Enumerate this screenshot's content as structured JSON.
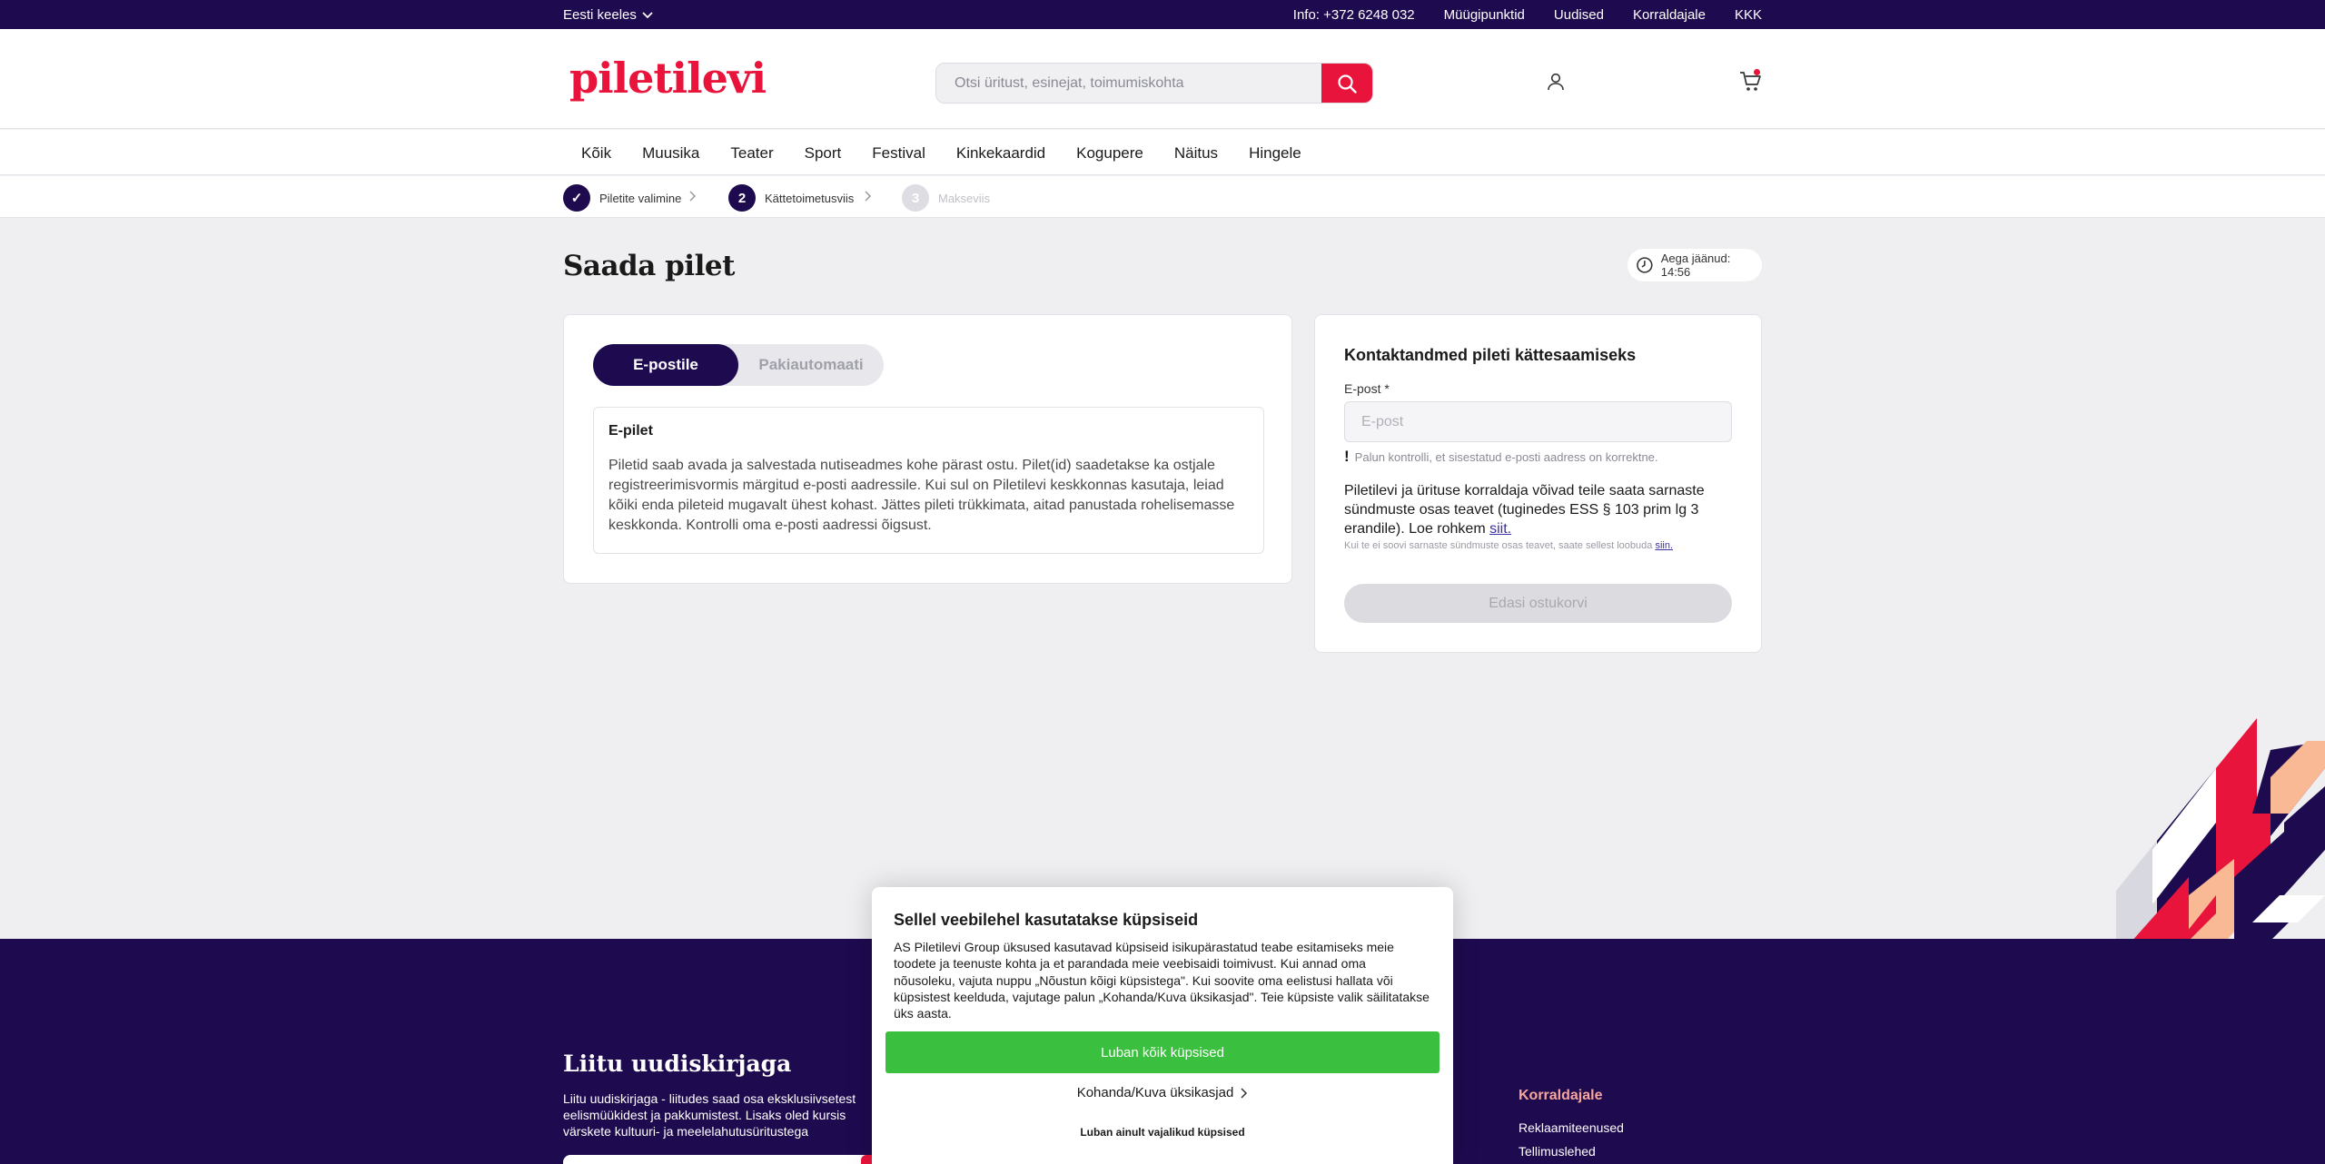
{
  "topbar": {
    "language": "Eesti keeles",
    "links": [
      "Info: +372 6248 032",
      "Müügipunktid",
      "Uudised",
      "Korraldajale",
      "KKK"
    ]
  },
  "header": {
    "logo": "piletilevi",
    "search_placeholder": "Otsi üritust, esinejat, toimumiskohta"
  },
  "nav": [
    "Kõik",
    "Muusika",
    "Teater",
    "Sport",
    "Festival",
    "Kinkekaardid",
    "Kogupere",
    "Näitus",
    "Hingele"
  ],
  "steps": [
    {
      "num": "✓",
      "label": "Piletite valimine"
    },
    {
      "num": "2",
      "label": "Kättetoimetusviis"
    },
    {
      "num": "3",
      "label": "Makseviis"
    }
  ],
  "main": {
    "title": "Saada pilet",
    "timer": "Aega jäänud: 14:56"
  },
  "delivery": {
    "tabs": [
      "E-postile",
      "Pakiautomaati"
    ],
    "box_title": "E-pilet",
    "box_text": "Piletid saab avada ja salvestada nutiseadmes kohe pärast ostu. Pilet(id) saadetakse ka ostjale registreerimisvormis märgitud e-posti aadressile. Kui sul on Piletilevi keskkonnas kasutaja, leiad kõiki enda pileteid mugavalt ühest kohast. Jättes pileti trükkimata, aitad panustada rohelisemasse keskkonda. Kontrolli oma e-posti aadressi õigsust."
  },
  "contact": {
    "title": "Kontaktandmed pileti kättesaamiseks",
    "email_label": "E-post *",
    "email_placeholder": "E-post",
    "warning": "Palun kontrolli, et sisestatud e-posti aadress on korrektne.",
    "info": "Piletilevi ja ürituse korraldaja võivad teile saata sarnaste sündmuste osas teavet (tuginedes ESS § 103 prim lg 3 erandile). Loe rohkem",
    "info_link": "siit.",
    "small": "Kui te ei soovi sarnaste sündmuste osas teavet, saate sellest loobuda",
    "small_link": "siin.",
    "button": "Edasi ostukorvi"
  },
  "footer": {
    "newsletter_title": "Liitu uudiskirjaga",
    "newsletter_text": "Liitu uudiskirjaga - liitudes saad osa eksklusiivsetest eelismüükidest ja pakkumistest. Lisaks oled kursis värskete kultuuri- ja meelelahutusüritustega",
    "col_title": "Korraldajale",
    "col_links": [
      "Reklaamiteenused",
      "Tellimuslehed"
    ]
  },
  "cookie": {
    "title": "Sellel veebilehel kasutatakse küpsiseid",
    "text": "AS Piletilevi Group üksused kasutavad küpsiseid isikupärastatud teabe esitamiseks meie toodete ja teenuste kohta ja et parandada meie veebisaidi toimivust. Kui annad oma nõusoleku, vajuta nuppu „Nõustun kõigi küpsistega\". Kui soovite oma eelistusi hallata või küpsistest keelduda, vajutage palun „Kohanda/Kuva üksikasjad\". Teie küpsiste valik säilitatakse üks aasta.",
    "accept": "Luban kõik küpsised",
    "customize": "Kohanda/Kuva üksikasjad",
    "necessary": "Luban ainult vajalikud küpsised"
  },
  "colors": {
    "brand_dark": "#1e0a4f",
    "brand_red": "#e8143c",
    "accept_green": "#3bbf3e"
  }
}
